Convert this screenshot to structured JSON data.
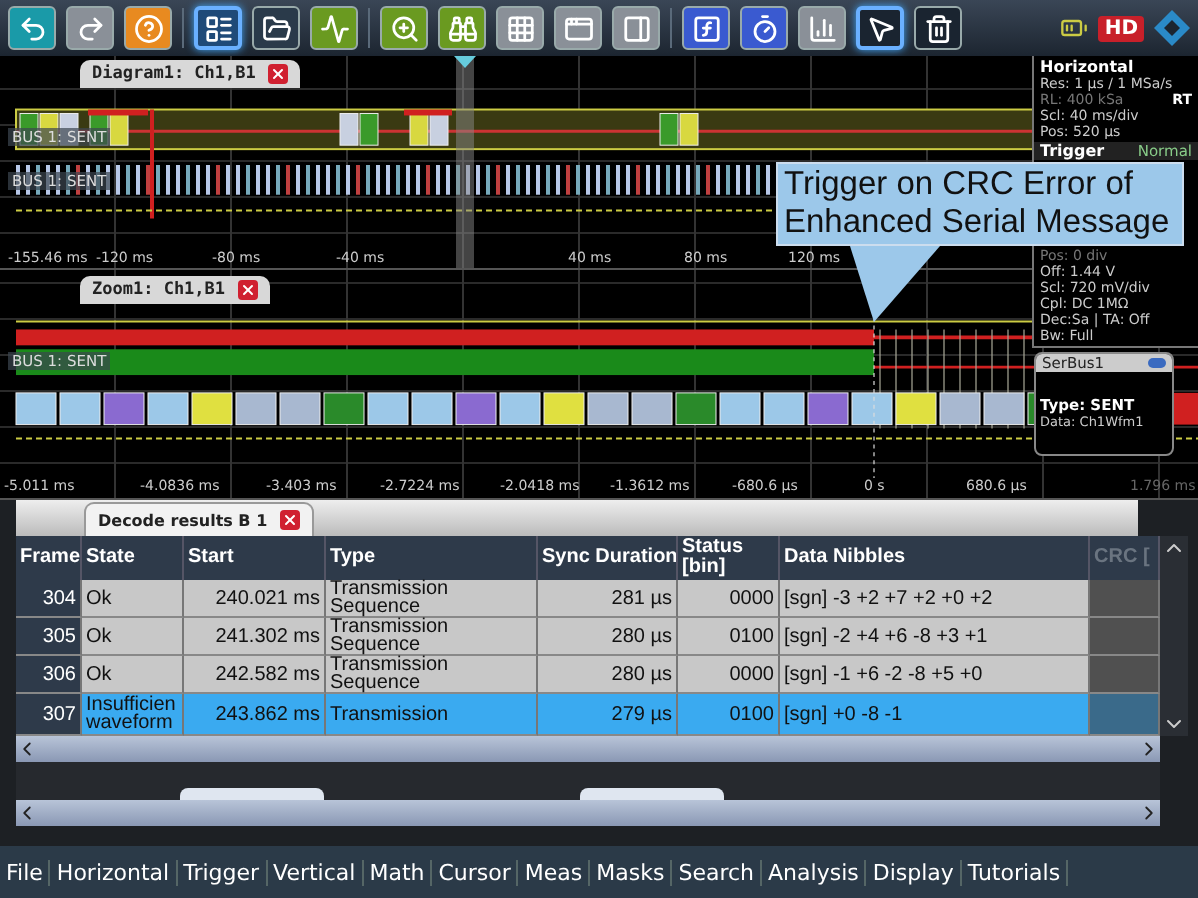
{
  "toolbar": {
    "tools": [
      {
        "color": "#1a9aa8",
        "selected": false
      },
      {
        "color": "#8a9098",
        "selected": false
      },
      {
        "color": "#e88a20",
        "selected": false
      },
      {
        "color": "#1f4a78",
        "selected": true
      },
      {
        "color": "#2a3a4a",
        "selected": false
      },
      {
        "color": "#6a9a20",
        "selected": false
      },
      {
        "color": "#6a9a20",
        "selected": false
      },
      {
        "color": "#6a9a20",
        "selected": false
      },
      {
        "color": "#8a9098",
        "selected": false
      },
      {
        "color": "#8a9098",
        "selected": false
      },
      {
        "color": "#8a9098",
        "selected": false
      },
      {
        "color": "#3a5ad0",
        "selected": false
      },
      {
        "color": "#3a5ad0",
        "selected": false
      },
      {
        "color": "#8a9098",
        "selected": false
      },
      {
        "color": "#1a2430",
        "selected": true
      },
      {
        "color": "#1a2430",
        "selected": false
      }
    ],
    "hd_badge": "HD"
  },
  "diagram": {
    "tab": "Diagram1: Ch1,B1",
    "bus_labels": [
      "BUS 1: SENT",
      "BUS 1: SENT"
    ],
    "axis": [
      "-155.46 ms",
      "-120 ms",
      "-80 ms",
      "-40 ms",
      "40 ms",
      "80 ms",
      "120 ms"
    ]
  },
  "info_panel": {
    "title": "Horizontal",
    "lines": [
      {
        "text": "Res: 1 µs / 1 MSa/s",
        "dim": false
      },
      {
        "text": "RL: 400 kSa",
        "dim": true
      },
      {
        "text": "Scl: 40 ms/div",
        "dim": false
      },
      {
        "text": "Pos: 520 µs",
        "dim": false
      }
    ],
    "mode": "RT",
    "trigger_title": "Trigger",
    "trigger_mode": "Normal",
    "channel_lines": [
      {
        "text": "Pos: 0 div",
        "dim": true
      },
      {
        "text": "Off: 1.44 V",
        "dim": false
      },
      {
        "text": "Scl: 720 mV/div",
        "dim": false
      },
      {
        "text": "Cpl: DC 1MΩ",
        "dim": false
      },
      {
        "text": "Dec:Sa | TA: Off",
        "dim": false
      },
      {
        "text": "Bw: Full",
        "dim": false
      }
    ]
  },
  "callout": "Trigger on CRC Error of Enhanced Serial Message",
  "zoom": {
    "tab": "Zoom1: Ch1,B1",
    "bus_label": "BUS 1: SENT",
    "axis": [
      {
        "text": "-5.011 ms",
        "dim": false
      },
      {
        "text": "-4.0836 ms",
        "dim": false
      },
      {
        "text": "-3.403 ms",
        "dim": false
      },
      {
        "text": "-2.7224 ms",
        "dim": false
      },
      {
        "text": "-2.0418 ms",
        "dim": false
      },
      {
        "text": "-1.3612 ms",
        "dim": false
      },
      {
        "text": "-680.6 µs",
        "dim": false
      },
      {
        "text": "0 s",
        "dim": false
      },
      {
        "text": "680.6 µs",
        "dim": false
      },
      {
        "text": "1.796 ms",
        "dim": true
      }
    ]
  },
  "serbus": {
    "title": "SerBus1",
    "type": "Type: SENT",
    "data": "Data: Ch1Wfm1"
  },
  "decode": {
    "tab": "Decode results B 1",
    "columns": [
      "Frame",
      "State",
      "Start",
      "Type",
      "Sync Duration",
      "Status [bin]",
      "Data Nibbles",
      "CRC ["
    ],
    "rows": [
      {
        "frame": "304",
        "state": "Ok",
        "start": "240.021 ms",
        "type": "Transmission Sequence",
        "sync": "281 µs",
        "status": "0000",
        "nibbles": "[sgn] -3  +2  +7  +2  +0  +2",
        "selected": false
      },
      {
        "frame": "305",
        "state": "Ok",
        "start": "241.302 ms",
        "type": "Transmission Sequence",
        "sync": "280 µs",
        "status": "0100",
        "nibbles": "[sgn] -2  +4  +6  -8  +3  +1",
        "selected": false
      },
      {
        "frame": "306",
        "state": "Ok",
        "start": "242.582 ms",
        "type": "Transmission Sequence",
        "sync": "280 µs",
        "status": "0000",
        "nibbles": "[sgn] -1  +6  -2  -8  +5  +0",
        "selected": false
      },
      {
        "frame": "307",
        "state": "Insufficien waveform",
        "start": "243.862 ms",
        "type": "Transmission",
        "sync": "279 µs",
        "status": "0100",
        "nibbles": "[sgn] +0  -8  -1",
        "selected": true
      }
    ]
  },
  "menu": [
    "File",
    "Horizontal",
    "Trigger",
    "Vertical",
    "Math",
    "Cursor",
    "Meas",
    "Masks",
    "Search",
    "Analysis",
    "Display",
    "Tutorials"
  ]
}
